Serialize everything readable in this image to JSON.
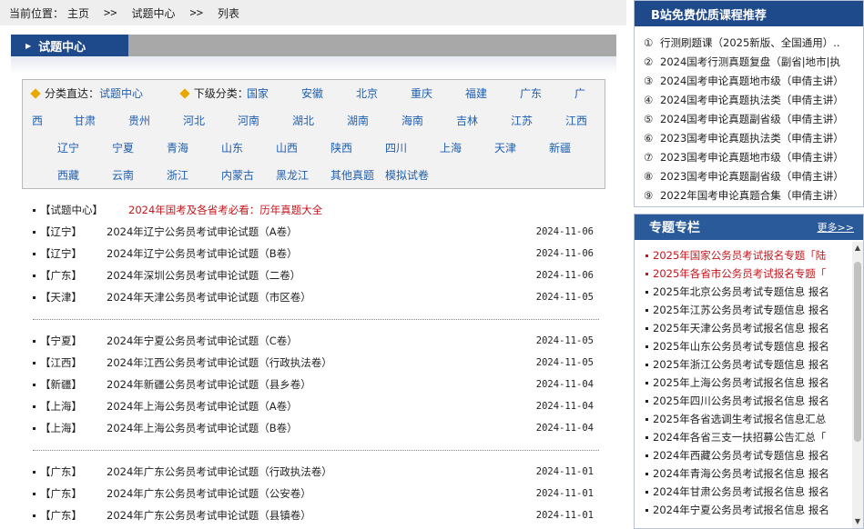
{
  "breadcrumb": {
    "prefix": "当前位置：",
    "home": "主页",
    "sep1": ">>",
    "section": "试题中心",
    "sep2": ">>",
    "current": "列表"
  },
  "section_title": "试题中心",
  "category": {
    "direct_label": "分类直达：",
    "direct_value": "试题中心",
    "sub_label": "下级分类：",
    "line1": [
      "国家",
      "安徽",
      "北京",
      "重庆",
      "福建",
      "广东",
      "广"
    ],
    "line2": [
      "西",
      "甘肃",
      "贵州",
      "河北",
      "河南",
      "湖北",
      "湖南",
      "海南",
      "吉林",
      "江苏",
      "江西"
    ],
    "line3": [
      "辽宁",
      "宁夏",
      "青海",
      "山东",
      "山西",
      "陕西",
      "四川",
      "上海",
      "天津",
      "新疆"
    ],
    "line4": [
      "西藏",
      "云南",
      "浙江",
      "内蒙古",
      "黑龙江",
      "其他真题",
      "模拟试卷"
    ]
  },
  "articles": {
    "featured": {
      "tag": "【试题中心】",
      "title": "2024年国考及各省考必看：历年真题大全"
    },
    "group1": [
      {
        "tag": "【辽宁】",
        "title": "2024年辽宁公务员考试申论试题（A卷）",
        "date": "2024-11-06"
      },
      {
        "tag": "【辽宁】",
        "title": "2024年辽宁公务员考试申论试题（B卷）",
        "date": "2024-11-06"
      },
      {
        "tag": "【广东】",
        "title": "2024年深圳公务员考试申论试题（二卷）",
        "date": "2024-11-06"
      },
      {
        "tag": "【天津】",
        "title": "2024年天津公务员考试申论试题（市区卷）",
        "date": "2024-11-05"
      }
    ],
    "group2": [
      {
        "tag": "【宁夏】",
        "title": "2024年宁夏公务员考试申论试题（C卷）",
        "date": "2024-11-05"
      },
      {
        "tag": "【江西】",
        "title": "2024年江西公务员考试申论试题（行政执法卷）",
        "date": "2024-11-05"
      },
      {
        "tag": "【新疆】",
        "title": "2024年新疆公务员考试申论试题（县乡卷）",
        "date": "2024-11-04"
      },
      {
        "tag": "【上海】",
        "title": "2024年上海公务员考试申论试题（A卷）",
        "date": "2024-11-04"
      },
      {
        "tag": "【上海】",
        "title": "2024年上海公务员考试申论试题（B卷）",
        "date": "2024-11-04"
      }
    ],
    "group3": [
      {
        "tag": "【广东】",
        "title": "2024年广东公务员考试申论试题（行政执法卷）",
        "date": "2024-11-01"
      },
      {
        "tag": "【广东】",
        "title": "2024年广东公务员考试申论试题（公安卷）",
        "date": "2024-11-01"
      },
      {
        "tag": "【广东】",
        "title": "2024年广东公务员考试申论试题（县镇卷）",
        "date": "2024-11-01"
      }
    ]
  },
  "courses": {
    "title": "B站免费优质课程推荐",
    "items": [
      {
        "num": "①",
        "text": "行测刷题课（2025新版、全国通用）.."
      },
      {
        "num": "②",
        "text": "2024国考行测真题复盘（副省|地市|执"
      },
      {
        "num": "③",
        "text": "2024国考申论真题地市级（申倩主讲）"
      },
      {
        "num": "④",
        "text": "2024国考申论真题执法类（申倩主讲）"
      },
      {
        "num": "⑤",
        "text": "2024国考申论真题副省级（申倩主讲）"
      },
      {
        "num": "⑥",
        "text": "2023国考申论真题执法类（申倩主讲）"
      },
      {
        "num": "⑦",
        "text": "2023国考申论真题地市级（申倩主讲）"
      },
      {
        "num": "⑧",
        "text": "2023国考申论真题副省级（申倩主讲）"
      },
      {
        "num": "⑨",
        "text": "2022年国考申论真题合集（申倩主讲）"
      }
    ]
  },
  "topics": {
    "title": "专题专栏",
    "more": "更多>>",
    "items": [
      {
        "text": "2025年国家公务员考试报名专题「陆",
        "red": true
      },
      {
        "text": "2025年各省市公务员考试报名专题「",
        "red": true
      },
      {
        "text": "2025年北京公务员考试专题信息 报名",
        "red": false
      },
      {
        "text": "2025年江苏公务员考试专题信息 报名",
        "red": false
      },
      {
        "text": "2025年天津公务员考试报名信息 报名",
        "red": false
      },
      {
        "text": "2025年山东公务员考试专题信息 报名",
        "red": false
      },
      {
        "text": "2025年浙江公务员考试专题信息 报名",
        "red": false
      },
      {
        "text": "2025年上海公务员考试报名信息 报名",
        "red": false
      },
      {
        "text": "2025年四川公务员考试报名信息 报名",
        "red": false
      },
      {
        "text": "2025年各省选调生考试报名信息汇总",
        "red": false
      },
      {
        "text": "2024年各省三支一扶招募公告汇总「",
        "red": false
      },
      {
        "text": "2024年西藏公务员考试专题信息 报名",
        "red": false
      },
      {
        "text": "2024年青海公务员考试报名信息 报名",
        "red": false
      },
      {
        "text": "2024年甘肃公务员考试报名信息 报名",
        "red": false
      },
      {
        "text": "2024年宁夏公务员考试报名信息 报名",
        "red": false
      }
    ]
  },
  "colors": {
    "accent": "#1e4a8c",
    "link": "#1f5fb0",
    "red": "#c4161c"
  }
}
